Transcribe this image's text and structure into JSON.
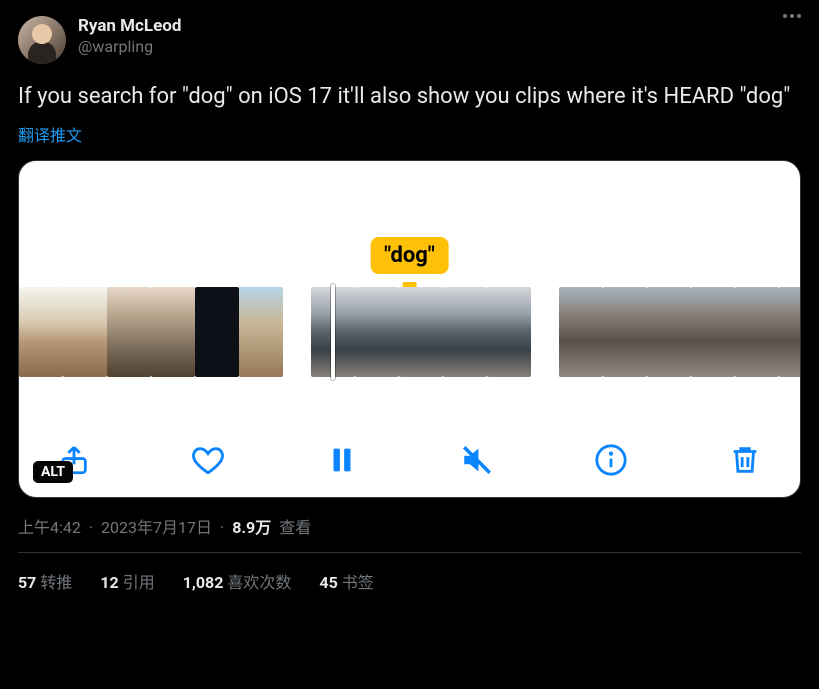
{
  "author": {
    "display_name": "Ryan McLeod",
    "username": "@warpling"
  },
  "tweet_text": "If you search for \"dog\" on iOS 17 it'll also show you clips where it's HEARD \"dog\"",
  "translate_label": "翻译推文",
  "media": {
    "tooltip_text": "\"dog\"",
    "alt_badge": "ALT"
  },
  "meta": {
    "time": "上午4:42",
    "date": "2023年7月17日",
    "views_number": "8.9万",
    "views_label": "查看"
  },
  "stats": {
    "retweets_num": "57",
    "retweets_label": "转推",
    "quotes_num": "12",
    "quotes_label": "引用",
    "likes_num": "1,082",
    "likes_label": "喜欢次数",
    "bookmarks_num": "45",
    "bookmarks_label": "书签"
  }
}
